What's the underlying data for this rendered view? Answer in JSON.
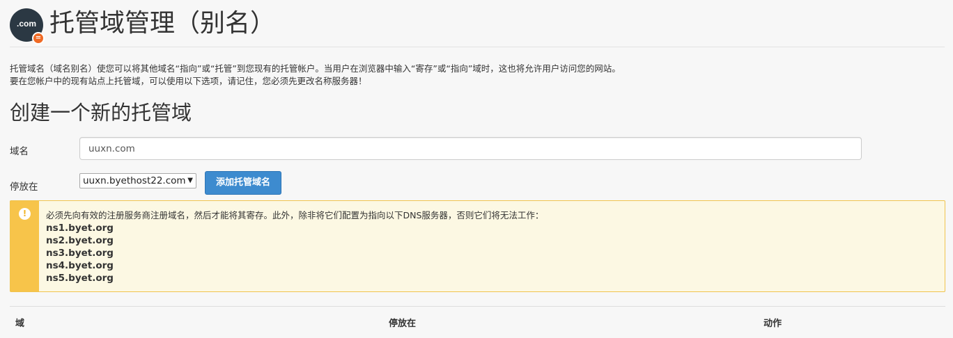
{
  "header": {
    "logo_text": ".com",
    "logo_badge": "=",
    "title": "托管域管理（别名）"
  },
  "description": {
    "line1": "托管域名（域名别名）使您可以将其他域名“指向”或“托管”到您现有的托管帐户。当用户在浏览器中输入“寄存”或“指向”域时，这也将允许用户访问您的网站。",
    "line2": "要在您帐户中的现有站点上托管域，可以使用以下选项，请记住，您必须先更改名称服务器！"
  },
  "form": {
    "section_title": "创建一个新的托管域",
    "domain_label": "域名",
    "domain_value": "uuxn.com",
    "park_label": "停放在",
    "park_selected": "uuxn.byethost22.com",
    "add_button": "添加托管域名"
  },
  "alert": {
    "icon": "!",
    "message": "必须先向有效的注册服务商注册域名，然后才能将其寄存。此外，除非将它们配置为指向以下DNS服务器，否则它们将无法工作：",
    "nameservers": [
      "ns1.byet.org",
      "ns2.byet.org",
      "ns3.byet.org",
      "ns4.byet.org",
      "ns5.byet.org"
    ]
  },
  "table": {
    "columns": [
      "域",
      "停放在",
      "动作"
    ]
  },
  "colors": {
    "primary_button": "#3d8bcf",
    "alert_bg": "#fcf8e3",
    "alert_accent": "#f7c44a",
    "logo_bg": "#2b3843",
    "logo_badge": "#f06a25"
  }
}
